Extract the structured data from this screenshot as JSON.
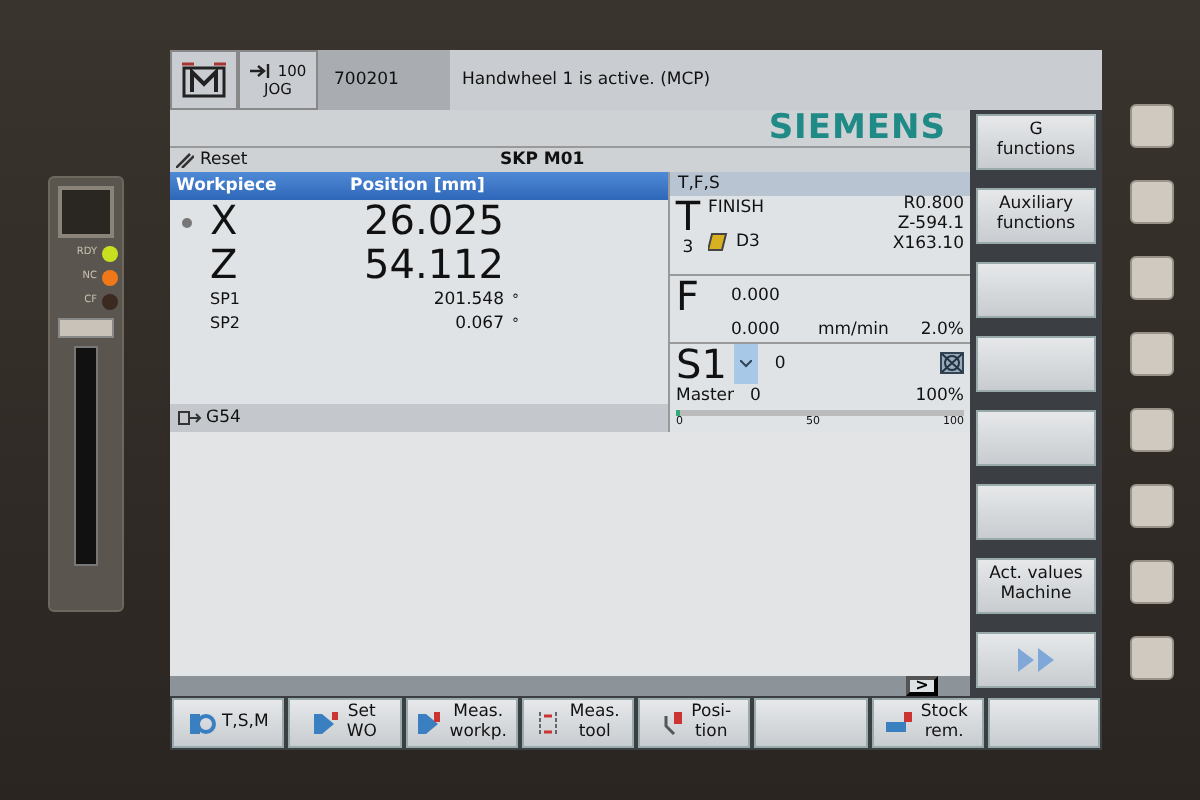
{
  "device_panel": {
    "leds": [
      {
        "label": "RDY",
        "color": "#c8e020"
      },
      {
        "label": "NC",
        "color": "#f07818"
      },
      {
        "label": "CF",
        "color": "#3a2a20"
      }
    ]
  },
  "header": {
    "mode_code": "100",
    "mode": "JOG",
    "program": "700201",
    "message": "Handwheel 1 is active. (MCP)"
  },
  "logo": "SIEMENS",
  "status": {
    "channel_state": "Reset",
    "program_flags": "SKP M01"
  },
  "position_panel": {
    "columns": [
      "Workpiece",
      "Position [mm]"
    ],
    "axes": [
      {
        "kind": "axis",
        "name": "X",
        "value": "26.025",
        "active": true
      },
      {
        "kind": "axis",
        "name": "Z",
        "value": "54.112",
        "active": false
      },
      {
        "kind": "spindle",
        "name": "SP1",
        "value": "201.548",
        "unit": "°",
        "active": false
      },
      {
        "kind": "spindle",
        "name": "SP2",
        "value": "0.067",
        "unit": "°",
        "active": false
      }
    ],
    "work_offset": "G54"
  },
  "tfs_panel": {
    "title": "T,F,S",
    "tool": {
      "letter": "T",
      "number": "3",
      "name": "FINISH",
      "edge": "D3",
      "radius": "R0.800",
      "z": "Z-594.1",
      "x": "X163.10"
    },
    "feed": {
      "letter": "F",
      "actual": "0.000",
      "programmed": "0.000",
      "unit": "mm/min",
      "override": "2.0%"
    },
    "spindle": {
      "name": "S1",
      "actual": "0",
      "mode": "Master",
      "programmed": "0",
      "override": "100%",
      "level": 0,
      "scale": [
        "0",
        "50",
        "100"
      ]
    }
  },
  "vertical_softkeys": [
    {
      "kind": "label",
      "label": "G\nfunctions"
    },
    {
      "kind": "label",
      "label": "Auxiliary\nfunctions"
    },
    {
      "kind": "blank"
    },
    {
      "kind": "blank"
    },
    {
      "kind": "blank"
    },
    {
      "kind": "blank"
    },
    {
      "kind": "label",
      "label": "Act. values\nMachine"
    },
    {
      "kind": "next"
    }
  ],
  "scroll_button": ">",
  "horizontal_softkeys": [
    {
      "kind": "label",
      "label": "T,S,M"
    },
    {
      "kind": "label",
      "label": "Set\nWO"
    },
    {
      "kind": "label",
      "label": "Meas.\nworkp."
    },
    {
      "kind": "label",
      "label": "Meas.\ntool"
    },
    {
      "kind": "label",
      "label": "Posi-\ntion"
    },
    {
      "kind": "blank"
    },
    {
      "kind": "label",
      "label": "Stock\nrem."
    },
    {
      "kind": "blank"
    }
  ]
}
